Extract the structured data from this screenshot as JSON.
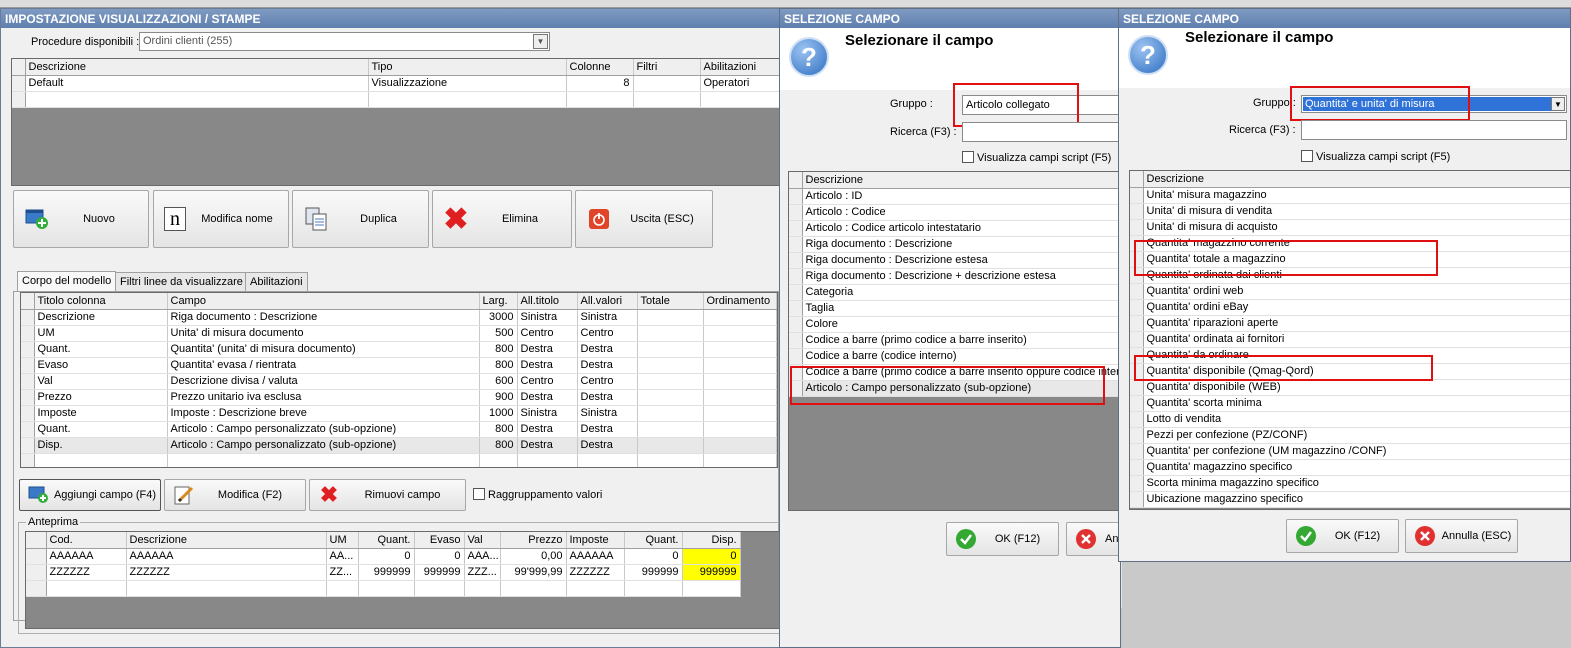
{
  "main": {
    "title": "IMPOSTAZIONE VISUALIZZAZIONI / STAMPE",
    "procedure_label": "Procedure disponibili :",
    "procedure_value": "Ordini clienti (255)",
    "top_grid": {
      "headers": [
        "Descrizione",
        "Tipo",
        "Colonne",
        "Filtri",
        "Abilitazioni"
      ],
      "rows": [
        [
          "Default",
          "Visualizzazione",
          "8",
          "",
          "Operatori"
        ]
      ]
    },
    "buttons": {
      "nuovo": "Nuovo",
      "modifica_nome": "Modifica nome",
      "duplica": "Duplica",
      "elimina": "Elimina",
      "uscita": "Uscita (ESC)"
    },
    "tabs": [
      "Corpo del modello",
      "Filtri linee da visualizzare",
      "Abilitazioni"
    ],
    "columns_grid": {
      "headers": [
        "Titolo colonna",
        "Campo",
        "Larg.",
        "All.titolo",
        "All.valori",
        "Totale",
        "Ordinamento"
      ],
      "rows": [
        [
          "Descrizione",
          "Riga documento : Descrizione",
          "3000",
          "Sinistra",
          "Sinistra"
        ],
        [
          "UM",
          "Unita' di misura documento",
          "500",
          "Centro",
          "Centro"
        ],
        [
          "Quant.",
          "Quantita' (unita' di misura documento)",
          "800",
          "Destra",
          "Destra"
        ],
        [
          "Evaso",
          "Quantita' evasa / rientrata",
          "800",
          "Destra",
          "Destra"
        ],
        [
          "Val",
          "Descrizione divisa / valuta",
          "600",
          "Centro",
          "Centro"
        ],
        [
          "Prezzo",
          "Prezzo unitario iva esclusa",
          "900",
          "Destra",
          "Destra"
        ],
        [
          "Imposte",
          "Imposte : Descrizione breve",
          "1000",
          "Sinistra",
          "Sinistra"
        ],
        [
          "Quant.",
          "Articolo : Campo personalizzato (sub-opzione)",
          "800",
          "Destra",
          "Destra"
        ],
        [
          "Disp.",
          "Articolo : Campo personalizzato (sub-opzione)",
          "800",
          "Destra",
          "Destra"
        ]
      ]
    },
    "bottom_buttons": {
      "aggiungi": "Aggiungi campo (F4)",
      "modifica": "Modifica (F2)",
      "rimuovi": "Rimuovi campo"
    },
    "raggruppamento_label": "Raggruppamento valori",
    "anteprima_label": "Anteprima",
    "preview_grid": {
      "headers": [
        "Cod.",
        "Descrizione",
        "UM",
        "Quant.",
        "Evaso",
        "Val",
        "Prezzo",
        "Imposte",
        "Quant.",
        "Disp."
      ],
      "rows": [
        [
          "AAAAAA",
          "AAAAAA",
          "AA...",
          "0",
          "0",
          "AAA...",
          "0,00",
          "AAAAAA",
          "0",
          "0"
        ],
        [
          "ZZZZZZ",
          "ZZZZZZ",
          "ZZ...",
          "999999",
          "999999",
          "ZZZ...",
          "99'999,99",
          "ZZZZZZ",
          "999999",
          "999999"
        ]
      ]
    }
  },
  "dialog1": {
    "title": "SELEZIONE CAMPO",
    "heading": "Selezionare il campo",
    "gruppo_label": "Gruppo :",
    "gruppo_value": "Articolo collegato",
    "ricerca_label": "Ricerca (F3) :",
    "script_label": "Visualizza campi script (F5)",
    "list_header": "Descrizione",
    "items": [
      "Articolo : ID",
      "Articolo : Codice",
      "Articolo : Codice articolo intestatario",
      "Riga documento : Descrizione",
      "Riga documento : Descrizione estesa",
      "Riga documento : Descrizione + descrizione estesa",
      "Categoria",
      "Taglia",
      "Colore",
      "Codice a barre (primo codice a barre inserito)",
      "Codice a barre (codice interno)",
      "Codice a barre (primo codice a barre inserito oppure codice interno)",
      "Articolo : Campo personalizzato (sub-opzione)"
    ],
    "ok_label": "OK (F12)",
    "annulla_label": "Annulla (ESC)"
  },
  "dialog2": {
    "title": "SELEZIONE CAMPO",
    "heading": "Selezionare il campo",
    "gruppo_label": "Gruppo :",
    "gruppo_value": "Quantita' e unita' di misura",
    "ricerca_label": "Ricerca (F3) :",
    "script_label": "Visualizza campi script (F5)",
    "list_header": "Descrizione",
    "items": [
      "Unita' misura magazzino",
      "Unita' di misura di vendita",
      "Unita' di misura di acquisto",
      "Quantita' magazzino corrente",
      "Quantita' totale a magazzino",
      "Quantita' ordinata dai clienti",
      "Quantita' ordini web",
      "Quantita' ordini eBay",
      "Quantita' riparazioni aperte",
      "Quantita' ordinata ai fornitori",
      "Quantita' da ordinare",
      "Quantita' disponibile (Qmag-Qord)",
      "Quantita' disponibile (WEB)",
      "Quantita' scorta minima",
      "Lotto di vendita",
      "Pezzi per confezione (PZ/CONF)",
      "Quantita' per confezione (UM magazzino /CONF)",
      "Quantita' magazzino specifico",
      "Scorta minima magazzino specifico",
      "Ubicazione magazzino specifico"
    ],
    "ok_label": "OK (F12)",
    "annulla_label": "Annulla (ESC)"
  },
  "colors": {
    "title_bar": "#5f7fae",
    "highlight_box": "#e01010",
    "disp_column": "#ffff00",
    "selected_group": "#2f72d8"
  }
}
